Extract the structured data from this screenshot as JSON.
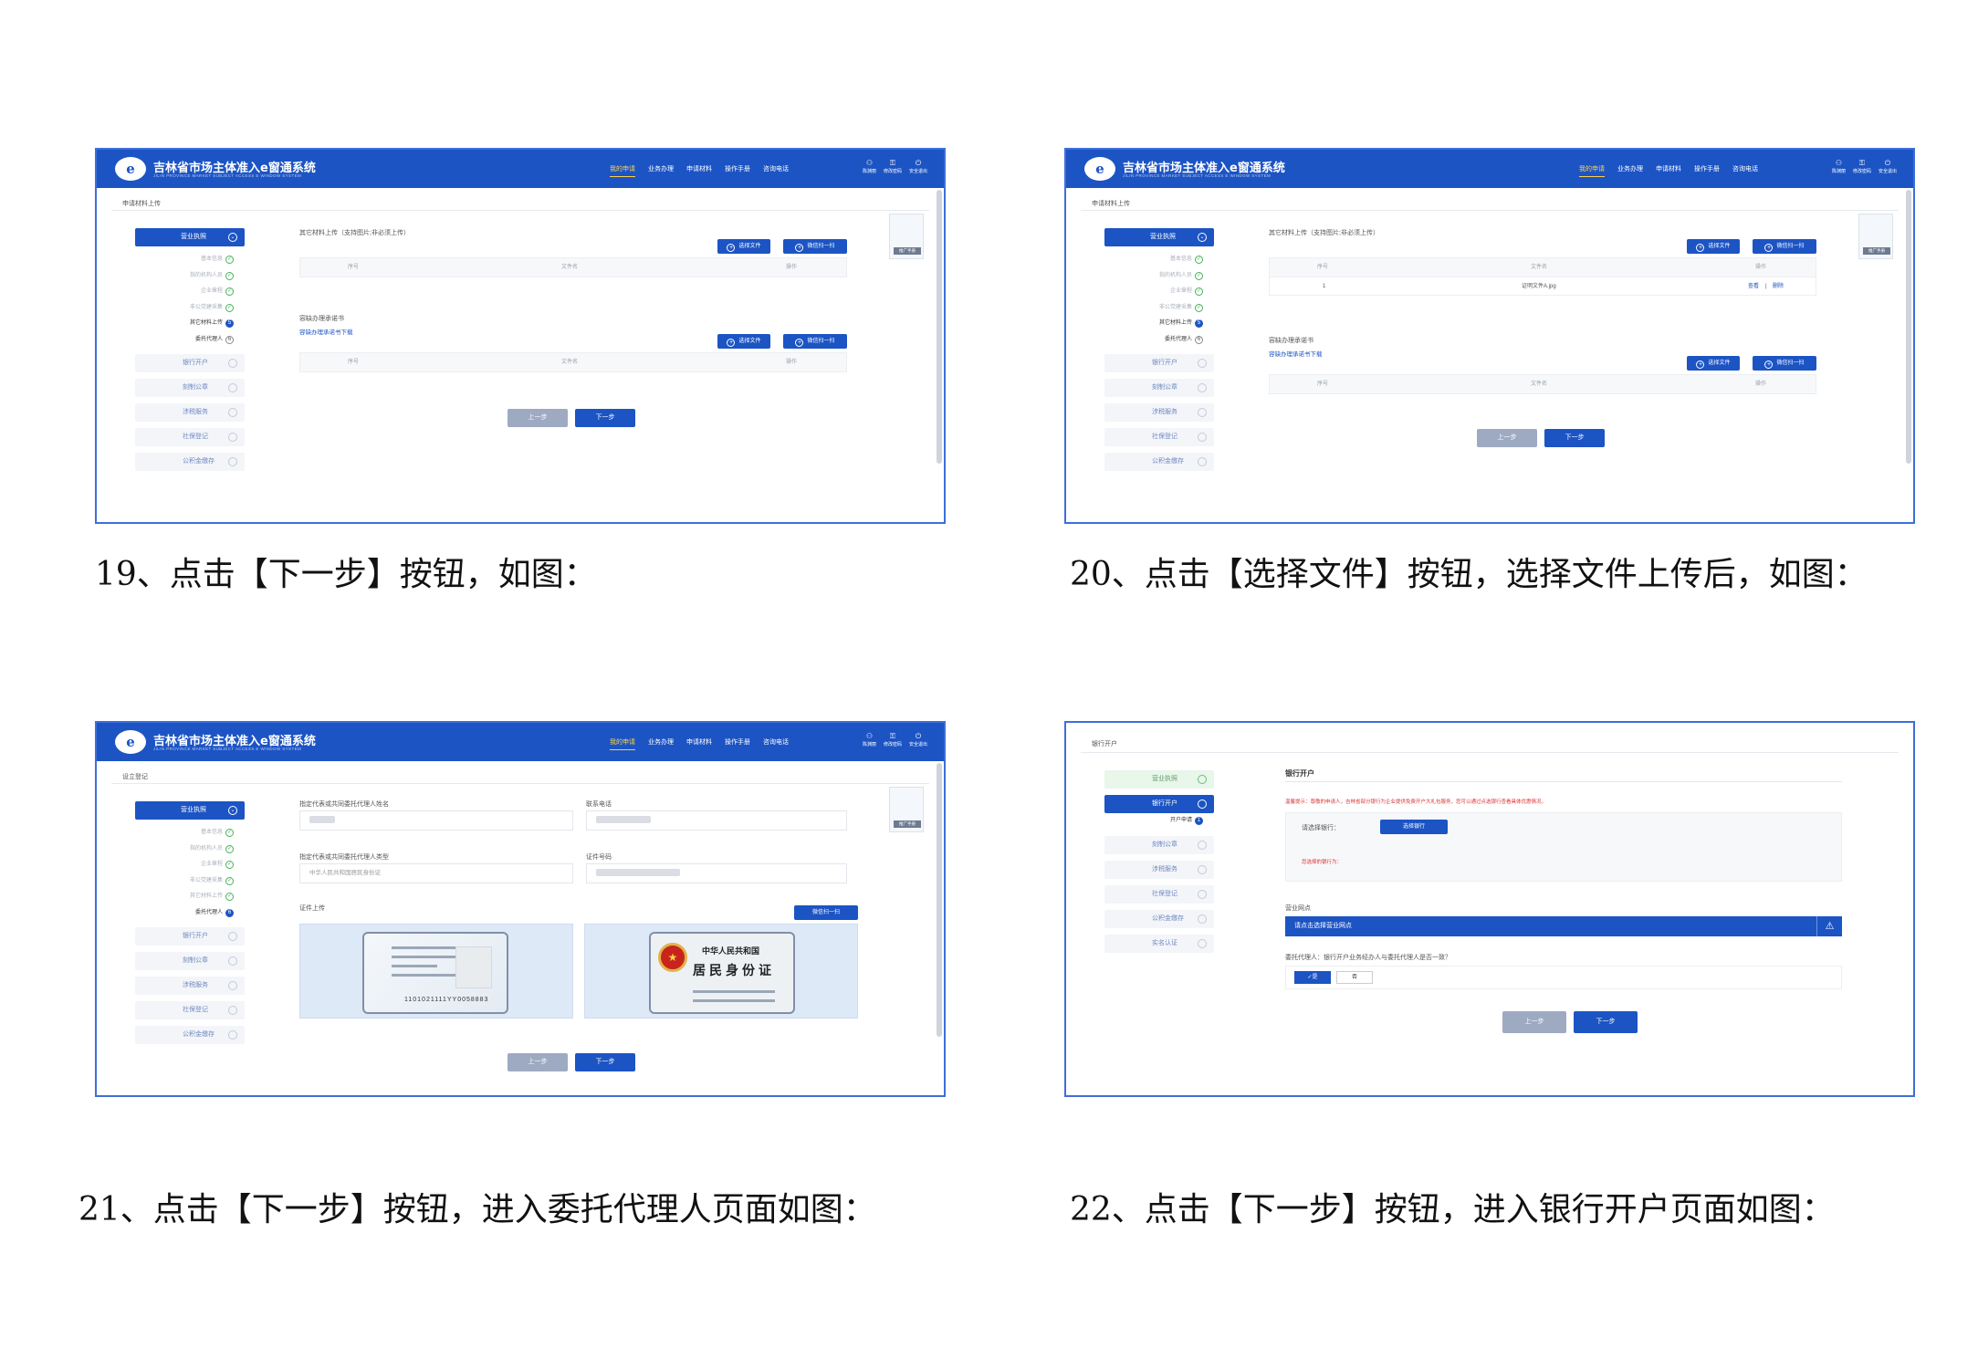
{
  "app": {
    "title": "吉林省市场主体准入e窗通系统",
    "subtitle": "JILIN PROVINCE MARKET SUBJECT ACCESS E WINDOW SYSTEM",
    "logo_text": "e",
    "nav": [
      "我的申请",
      "业务办理",
      "申请材料",
      "操作手册",
      "咨询电话"
    ],
    "sys": [
      {
        "icon": "user-icon",
        "glyph": "⚇",
        "label": "陈渊丽"
      },
      {
        "icon": "lock-icon",
        "glyph": "⚿",
        "label": "修改密码"
      },
      {
        "icon": "power-icon",
        "glyph": "⏻",
        "label": "安全退出"
      }
    ]
  },
  "sidebar": {
    "main": "营业执照",
    "subs": [
      "基本信息",
      "指的机构人员",
      "企业章程",
      "非公党建采集",
      "其它材料上传",
      "委托代理人"
    ],
    "steps": [
      "银行开户",
      "刻制公章",
      "涉税服务",
      "社保登记",
      "公积金缴存"
    ]
  },
  "common": {
    "prev": "上一步",
    "next": "下一步",
    "choose_file": "选择文件",
    "wechat_scan": "微信扫一扫",
    "qr_tag": "推广手册",
    "col_no": "序号",
    "col_file": "文件名",
    "col_op": "操作"
  },
  "s19": {
    "crumb": "申请材料上传",
    "sec1": "其它材料上传（支持图片;非必须上传）",
    "sec2": "容缺办理承诺书",
    "template_link": "容缺办理承诺书下载"
  },
  "s20": {
    "crumb": "申请材料上传",
    "sec1": "其它材料上传（支持图片;非必须上传）",
    "row": {
      "no": "1",
      "file": "证明文件A.jpg",
      "view": "查看",
      "sep": "|",
      "del": "删除"
    },
    "sec2": "容缺办理承诺书",
    "template_link": "容缺办理承诺书下载"
  },
  "s21": {
    "crumb": "设立登记",
    "name_label": "指定代表或共同委托代理人姓名",
    "phone_label": "联系电话",
    "type_label": "指定代表或共同委托代理人类型",
    "type_value": "中华人民共和国居民身份证",
    "idno_label": "证件号码",
    "upload_label": "证件上传",
    "id_number": "1101021111YY0058883",
    "back_t1": "中华人民共和国",
    "back_t2": "居民身份证",
    "emblem": "★"
  },
  "s22": {
    "crumb": "银行开户",
    "title": "银行开户",
    "hint": "温馨提示：尊敬的申请人，吉林省部分银行为企业提供免费开户大礼包服务，您可以通过点选银行查看具体优惠情况。",
    "choose_label": "请选择银行：",
    "choose_btn": "选择银行",
    "chosen_label": "您选择的银行为：",
    "branch_label": "营业网点",
    "branch_placeholder": "请点击选择营业网点",
    "agent_label": "委托代理人：银行开户业务经办人与委托代理人是否一致？",
    "yes": "✓是",
    "no": "否",
    "sub": "开户申请",
    "steps": [
      "营业执照",
      "银行开户",
      "刻制公章",
      "涉税服务",
      "社保登记",
      "公积金缴存",
      "实名认证"
    ]
  },
  "captions": {
    "c19": "19、点击【下一步】按钮，如图：",
    "c20": "20、点击【选择文件】按钮，选择文件上传后，如图：",
    "c21": "21、点击【下一步】按钮，进入委托代理人页面如图：",
    "c22": "22、点击【下一步】按钮，进入银行开户页面如图："
  },
  "colors": {
    "accent": "#1c54c4",
    "border": "#3d6fd8",
    "nav_active": "#ffd24a",
    "success": "#45b35a",
    "warning": "#dd3333"
  }
}
